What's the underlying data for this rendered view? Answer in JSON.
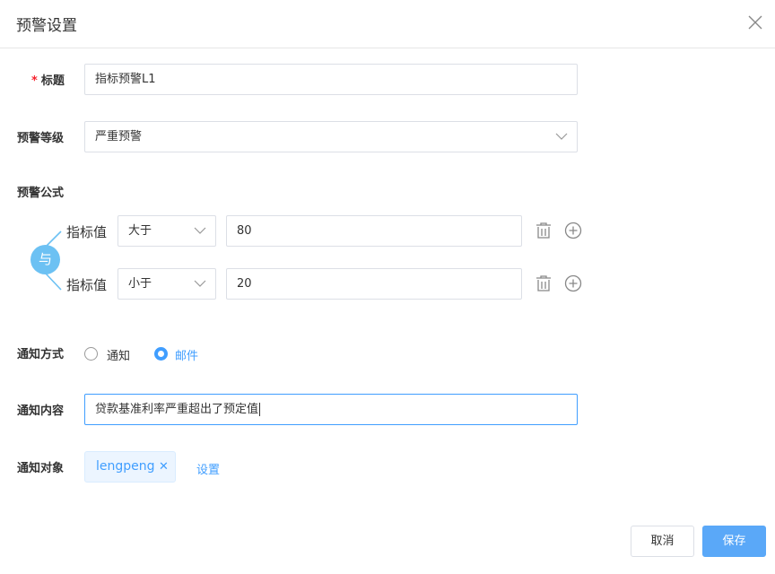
{
  "dialog": {
    "title": "预警设置",
    "close_icon": "close-icon"
  },
  "form": {
    "title_field": {
      "required_mark": "*",
      "label": "标题",
      "value": "指标预警L1"
    },
    "level_field": {
      "label": "预警等级",
      "value": "严重预警"
    },
    "formula": {
      "label": "预警公式",
      "connector": "与",
      "conditions": [
        {
          "label": "指标值",
          "operator": "大于",
          "value": "80"
        },
        {
          "label": "指标值",
          "operator": "小于",
          "value": "20"
        }
      ]
    },
    "notify_method": {
      "label": "通知方式",
      "options": [
        {
          "label": "通知",
          "checked": false
        },
        {
          "label": "邮件",
          "checked": true
        }
      ]
    },
    "notify_content": {
      "label": "通知内容",
      "value": "贷款基准利率严重超出了预定值"
    },
    "notify_target": {
      "label": "通知对象",
      "tags": [
        "lengpeng"
      ],
      "set_link": "设置"
    }
  },
  "footer": {
    "cancel_label": "取消",
    "save_label": "保存"
  },
  "colors": {
    "accent": "#409eff",
    "primary_button": "#5aa8f8",
    "required": "#f5222d",
    "connector": "#6cc1f3"
  }
}
